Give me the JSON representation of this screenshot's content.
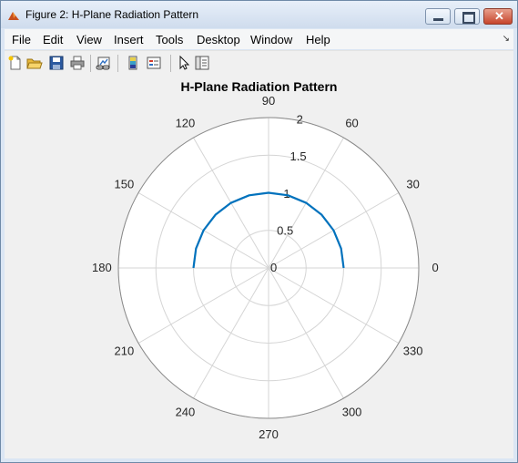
{
  "window": {
    "title": "Figure 2: H-Plane Radiation Pattern"
  },
  "menu": [
    "File",
    "Edit",
    "View",
    "Insert",
    "Tools",
    "Desktop",
    "Window",
    "Help"
  ],
  "toolbar_icons": [
    "new-figure-icon",
    "open-file-icon",
    "save-icon",
    "print-icon",
    "link-plot-icon",
    "colorbar-icon",
    "legend-icon",
    "pointer-icon",
    "property-editor-icon"
  ],
  "colors": {
    "trace": "#0072bd",
    "grid": "#d5d5d5",
    "axes_bg": "#ffffff",
    "figure_bg": "#f0f0f0"
  },
  "chart_data": {
    "type": "line",
    "coordinates": "polar",
    "title": "H-Plane Radiation Pattern",
    "theta_ticks": [
      "0",
      "30",
      "60",
      "90",
      "120",
      "150",
      "180",
      "210",
      "240",
      "270",
      "300",
      "330"
    ],
    "r_ticks": [
      "0",
      "0.5",
      "1",
      "1.5",
      "2"
    ],
    "r_lim": [
      0,
      2
    ],
    "grid": true,
    "series": [
      {
        "theta_deg": [
          0,
          15,
          30,
          45,
          60,
          75,
          90,
          105,
          120,
          135,
          150,
          165,
          180
        ],
        "r": [
          1,
          1,
          1,
          1,
          1,
          1,
          1,
          1,
          1,
          1,
          1,
          1,
          1
        ]
      }
    ]
  }
}
